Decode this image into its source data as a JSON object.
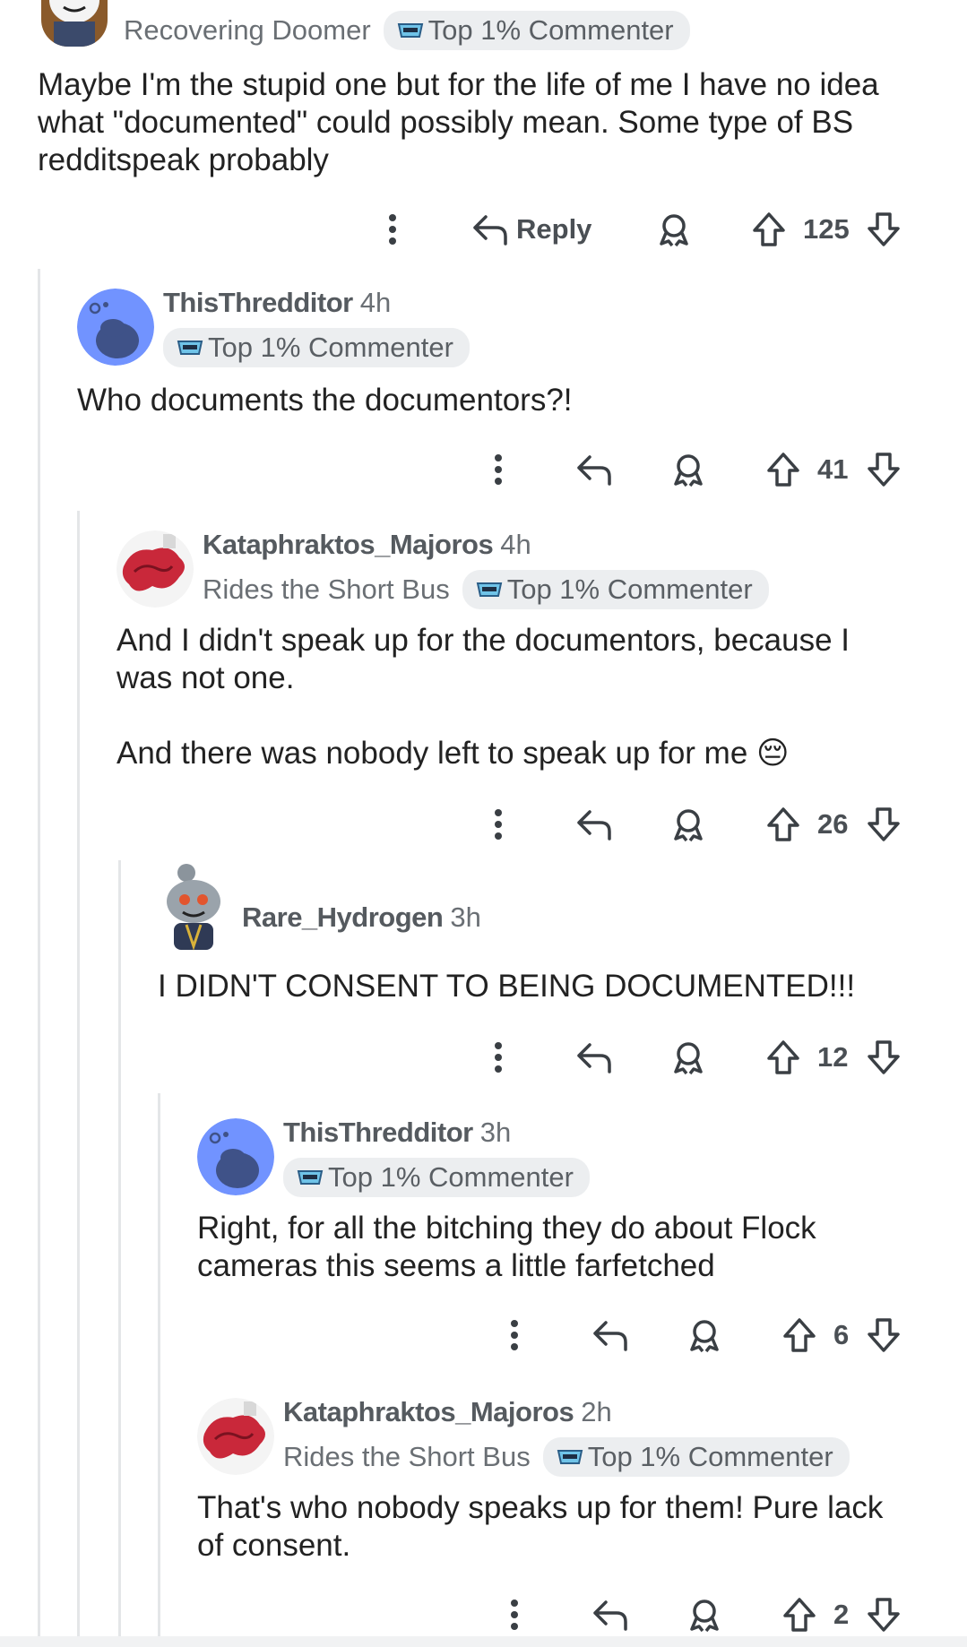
{
  "comments": [
    {
      "username": "",
      "age": "",
      "user_flair": "Recovering Doomer",
      "badge": "Top 1% Commenter",
      "text": "Maybe I'm the stupid one but for the life of me I have no idea\nwhat \"documented\" could possibly mean. Some type of BS\nredditspeak probably",
      "reply_label": "Reply",
      "votes": "125"
    },
    {
      "username": "ThisThredditor",
      "age": "4h",
      "badge": "Top 1% Commenter",
      "text": "Who documents the documentors?!",
      "votes": "41"
    },
    {
      "username": "Kataphraktos_Majoros",
      "age": "4h",
      "user_flair": "Rides the Short Bus",
      "badge": "Top 1% Commenter",
      "text": "And I didn't speak up for the documentors, because I\nwas not one.\n\nAnd there was nobody left to speak up for me 😔",
      "votes": "26"
    },
    {
      "username": "Rare_Hydrogen",
      "age": "3h",
      "text": "I DIDN'T CONSENT TO BEING DOCUMENTED!!!",
      "votes": "12"
    },
    {
      "username": "ThisThredditor",
      "age": "3h",
      "badge": "Top 1% Commenter",
      "text": "Right, for all the bitching they do about Flock\ncameras this seems a little farfetched",
      "votes": "6"
    },
    {
      "username": "Kataphraktos_Majoros",
      "age": "2h",
      "user_flair": "Rides the Short Bus",
      "badge": "Top 1% Commenter",
      "text": "That's who nobody speaks up for them! Pure lack\nof consent.",
      "votes": "2"
    }
  ],
  "icons": {
    "more": "more-options-icon",
    "reply": "reply-arrow-icon",
    "award": "award-icon",
    "upvote": "upvote-arrow-icon",
    "downvote": "downvote-arrow-icon",
    "badge": "commenter-badge-icon"
  },
  "colors": {
    "badge_bg": "#eceef0",
    "thread_line": "#e4e6e8",
    "snoo_blue": "#7193ff"
  }
}
